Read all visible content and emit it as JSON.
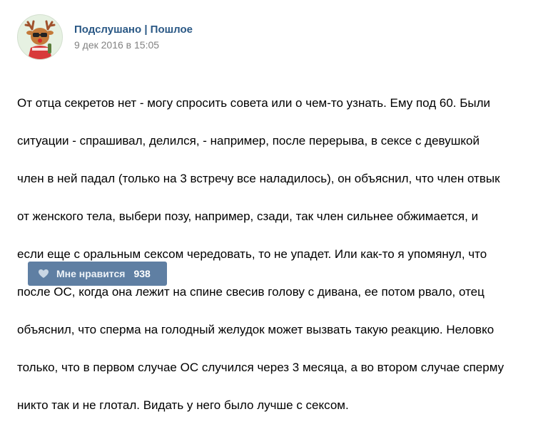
{
  "post": {
    "author": "Подслушано | Пошлое",
    "date": "9 дек 2016 в 15:05",
    "lines": [
      "От отца секретов нет - могу спросить совета или о чем-то узнать. Ему под 60. Были",
      "ситуации - спрашивал, делился, - например, после перерыва, в сексе с девушкой",
      "член в ней падал (только на 3 встречу все наладилось), он объяснил, что член отвык",
      "от женского тела, выбери позу, например, сзади, так член сильнее обжимается, и",
      "если еще с оральным сексом чередовать, то не упадет. Или как-то я упомянул, что",
      "после ОС, когда она лежит на спине свесив голову с дивана, ее потом рвало, отец",
      "объяснил, что сперма на голодный желудок может вызвать такую реакцию. Неловко",
      "только, что в первом случае ОС случился через 3 месяца, а во втором случае сперму",
      "никто так и не глотал. Видать у него было лучше с сексом."
    ]
  },
  "like_button": {
    "label": "Мне нравится",
    "count": "938",
    "icon": "heart-icon"
  },
  "colors": {
    "link": "#2a5885",
    "date": "#828282",
    "button_bg": "#5f7fa3"
  }
}
